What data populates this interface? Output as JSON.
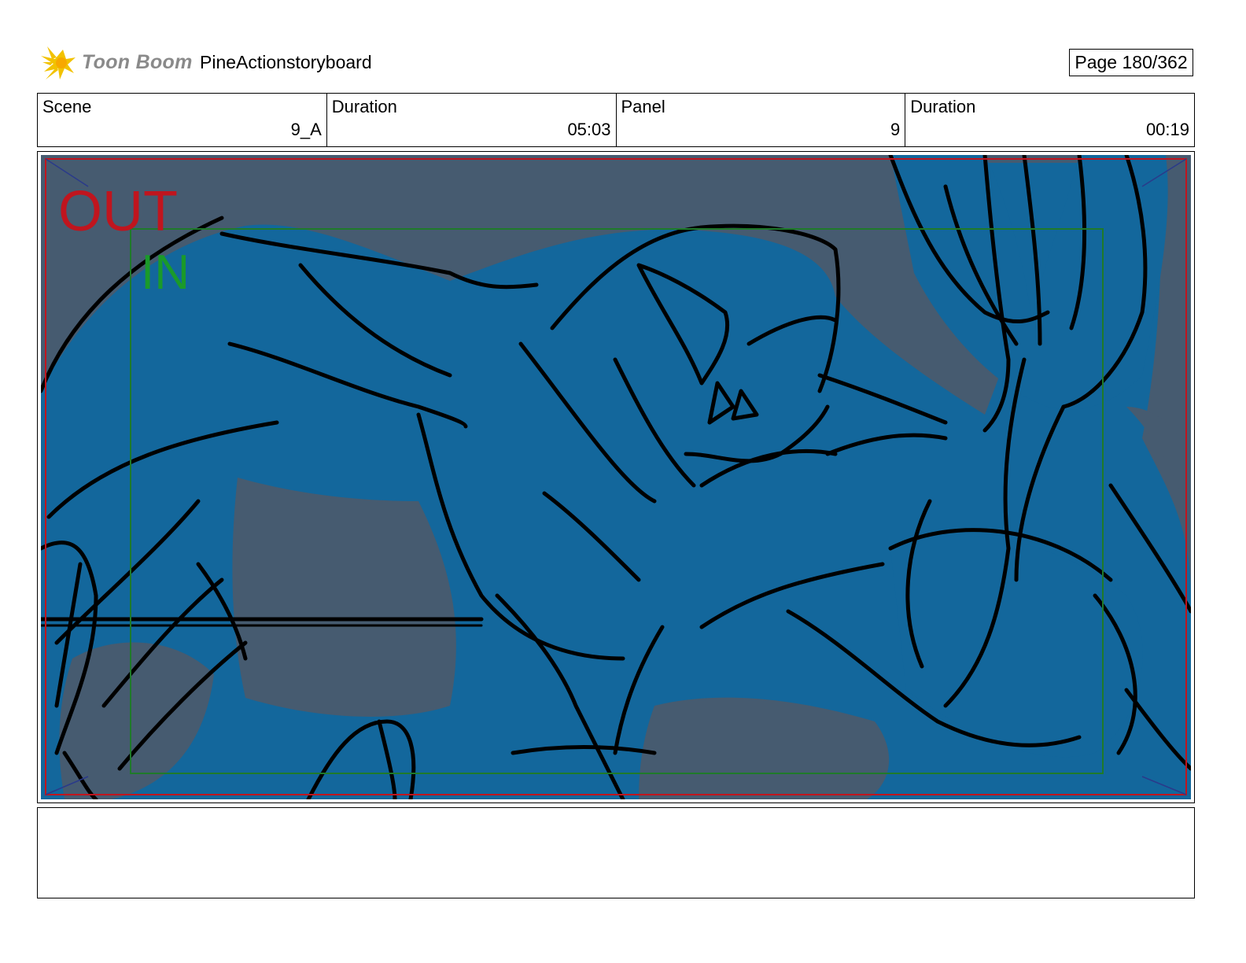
{
  "header": {
    "logo_text": "Toon Boom",
    "project_title": "PineActionstoryboard",
    "page_label": "Page 180/362"
  },
  "info": [
    {
      "label": "Scene",
      "value": "9_A"
    },
    {
      "label": "Duration",
      "value": "05:03"
    },
    {
      "label": "Panel",
      "value": "9"
    },
    {
      "label": "Duration",
      "value": "00:19"
    }
  ],
  "panel": {
    "out_label": "OUT",
    "in_label": "IN",
    "colors": {
      "background": "#465b70",
      "figure": "#13679c",
      "line": "#000000",
      "out_frame": "#c0151e",
      "in_frame": "#1f7a2a",
      "out_text": "#c0151e",
      "in_text": "#1a9a2a"
    }
  },
  "notes": {
    "text": ""
  }
}
